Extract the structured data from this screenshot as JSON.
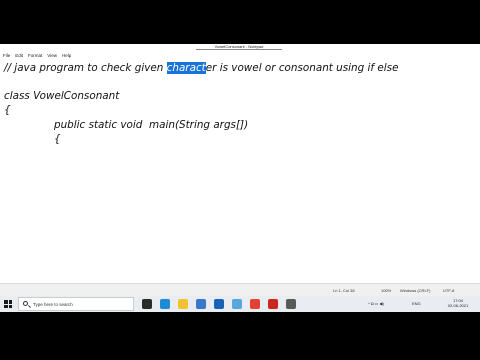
{
  "window": {
    "title": "VowelConsonant - Notepad"
  },
  "menu": [
    {
      "label": "File"
    },
    {
      "label": "Edit"
    },
    {
      "label": "Format"
    },
    {
      "label": "View"
    },
    {
      "label": "Help"
    }
  ],
  "editor": {
    "line1_pre": "// java program to check given ",
    "line1_selected": "charact",
    "line1_post": "er is vowel or consonant using if else",
    "line2": "class VowelConsonant",
    "line3": "{",
    "line4": "public static void  main(String args[])",
    "line5": "{"
  },
  "status": {
    "position": "Ln 1, Col 38",
    "zoom": "100%",
    "line_ending": "Windows (CRLF)",
    "encoding": "UTF-8"
  },
  "taskbar": {
    "search_placeholder": "Type here to search",
    "language": "ENG",
    "time": "17:04",
    "date": "02-06-2021",
    "apps": [
      {
        "icon": "task-view-icon",
        "color": "#2b2b2b"
      },
      {
        "icon": "edge-icon",
        "color": "#1f8ad6"
      },
      {
        "icon": "file-explorer-icon",
        "color": "#f2c230"
      },
      {
        "icon": "store-icon",
        "color": "#3a78c8"
      },
      {
        "icon": "mail-icon",
        "color": "#1a62b8"
      },
      {
        "icon": "notepad-icon",
        "color": "#5aa7e0"
      },
      {
        "icon": "chrome-icon",
        "color": "#e34133"
      },
      {
        "icon": "media-icon",
        "color": "#c7271d"
      },
      {
        "icon": "extra-icon",
        "color": "#5a5a5a"
      }
    ]
  }
}
